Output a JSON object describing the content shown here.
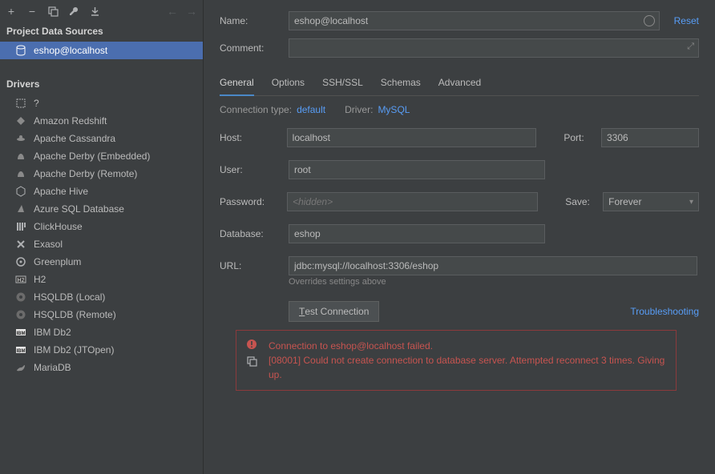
{
  "toolbar": {
    "add": "+",
    "remove": "−"
  },
  "sidebar": {
    "sources_title": "Project Data Sources",
    "sources": [
      {
        "label": "eshop@localhost",
        "icon": "datasource-icon"
      }
    ],
    "drivers_title": "Drivers",
    "drivers": [
      {
        "label": "?",
        "icon": "unknown-icon"
      },
      {
        "label": "Amazon Redshift",
        "icon": "redshift-icon"
      },
      {
        "label": "Apache Cassandra",
        "icon": "cassandra-icon"
      },
      {
        "label": "Apache Derby (Embedded)",
        "icon": "derby-icon"
      },
      {
        "label": "Apache Derby (Remote)",
        "icon": "derby-icon"
      },
      {
        "label": "Apache Hive",
        "icon": "hive-icon"
      },
      {
        "label": "Azure SQL Database",
        "icon": "azure-icon"
      },
      {
        "label": "ClickHouse",
        "icon": "clickhouse-icon"
      },
      {
        "label": "Exasol",
        "icon": "exasol-icon"
      },
      {
        "label": "Greenplum",
        "icon": "greenplum-icon"
      },
      {
        "label": "H2",
        "icon": "h2-icon"
      },
      {
        "label": "HSQLDB (Local)",
        "icon": "hsqldb-icon"
      },
      {
        "label": "HSQLDB (Remote)",
        "icon": "hsqldb-icon"
      },
      {
        "label": "IBM Db2",
        "icon": "ibm-icon"
      },
      {
        "label": "IBM Db2 (JTOpen)",
        "icon": "ibm-icon"
      },
      {
        "label": "MariaDB",
        "icon": "mariadb-icon"
      }
    ]
  },
  "form": {
    "name_label": "Name:",
    "name_value": "eshop@localhost",
    "reset": "Reset",
    "comment_label": "Comment:",
    "comment_value": ""
  },
  "tabs": [
    {
      "label": "General",
      "active": true
    },
    {
      "label": "Options",
      "active": false
    },
    {
      "label": "SSH/SSL",
      "active": false
    },
    {
      "label": "Schemas",
      "active": false
    },
    {
      "label": "Advanced",
      "active": false
    }
  ],
  "conn": {
    "type_label": "Connection type:",
    "type_value": "default",
    "driver_label": "Driver:",
    "driver_value": "MySQL",
    "host_label": "Host:",
    "host_value": "localhost",
    "port_label": "Port:",
    "port_value": "3306",
    "user_label": "User:",
    "user_value": "root",
    "password_label": "Password:",
    "password_placeholder": "<hidden>",
    "save_label": "Save:",
    "save_value": "Forever",
    "database_label": "Database:",
    "database_value": "eshop",
    "url_label": "URL:",
    "url_value": "jdbc:mysql://localhost:3306/eshop",
    "url_hint": "Overrides settings above",
    "test_btn_prefix": "T",
    "test_btn_rest": "est Connection",
    "troubleshoot": "Troubleshooting"
  },
  "error": {
    "line1": "Connection to eshop@localhost failed.",
    "line2": "[08001] Could not create connection to database server. Attempted reconnect 3 times. Giving up."
  }
}
